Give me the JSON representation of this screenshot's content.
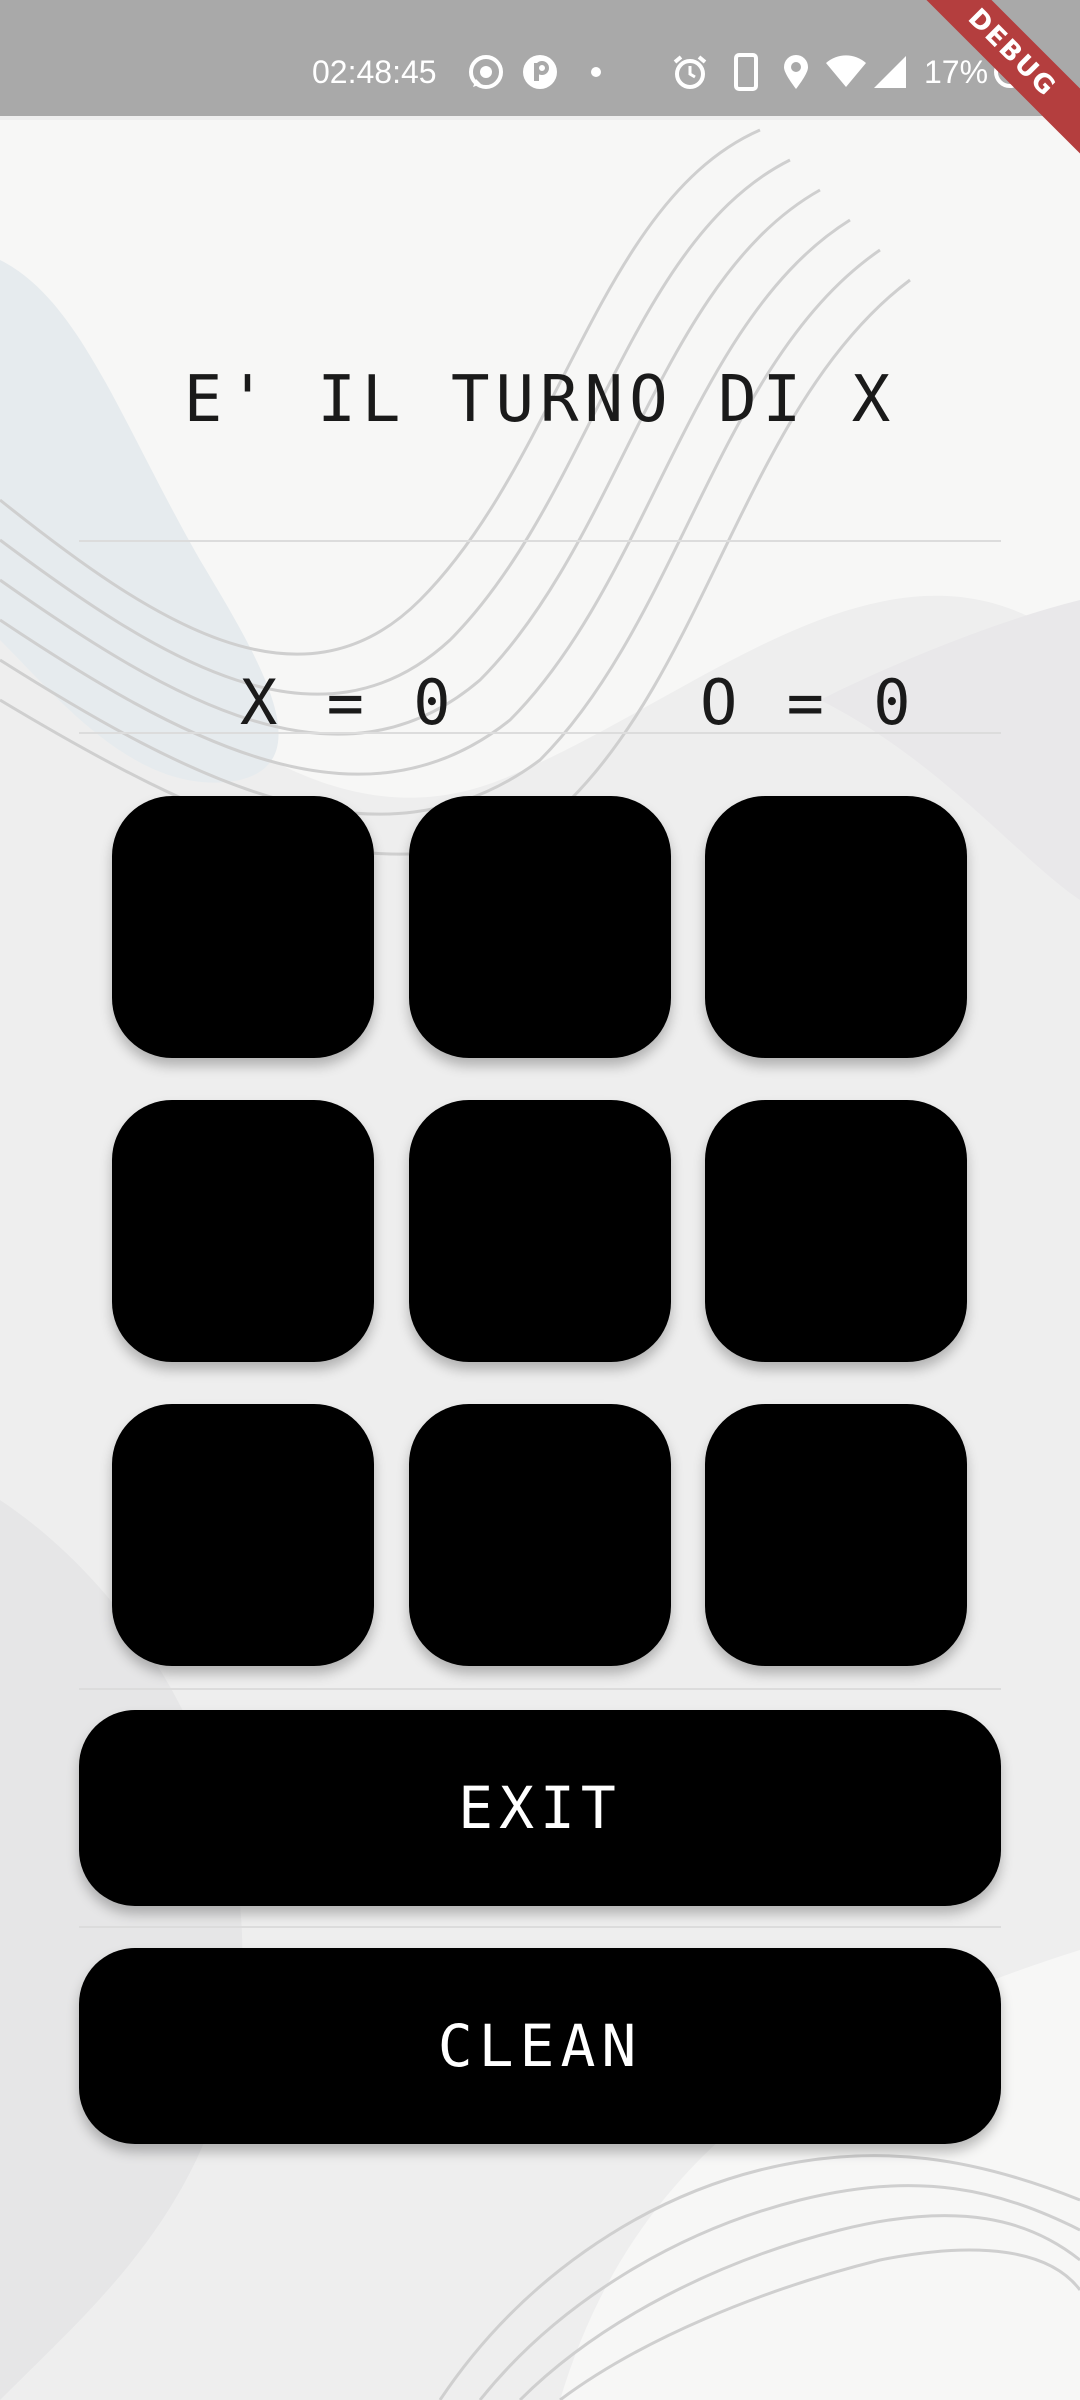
{
  "status_bar": {
    "time": "02:48:45",
    "icons": [
      "whatsapp-icon",
      "app-p-icon",
      "dot-icon",
      "alarm-icon",
      "phone-icon",
      "location-icon",
      "wifi-icon",
      "signal-icon",
      "battery-icon"
    ],
    "battery": "17%",
    "debug_label": "DEBUG"
  },
  "game": {
    "turn_text": "E' IL TURNO DI X",
    "score_x": "X = 0",
    "score_o": "O = 0",
    "board": [
      "",
      "",
      "",
      "",
      "",
      "",
      "",
      "",
      ""
    ]
  },
  "buttons": {
    "exit_label": "EXIT",
    "clean_label": "CLEAN"
  },
  "colors": {
    "status_bar": "#a9a9a9",
    "cell": "#000000",
    "button": "#000000",
    "button_text": "#ffffff",
    "debug_ribbon": "#b43e3e"
  }
}
